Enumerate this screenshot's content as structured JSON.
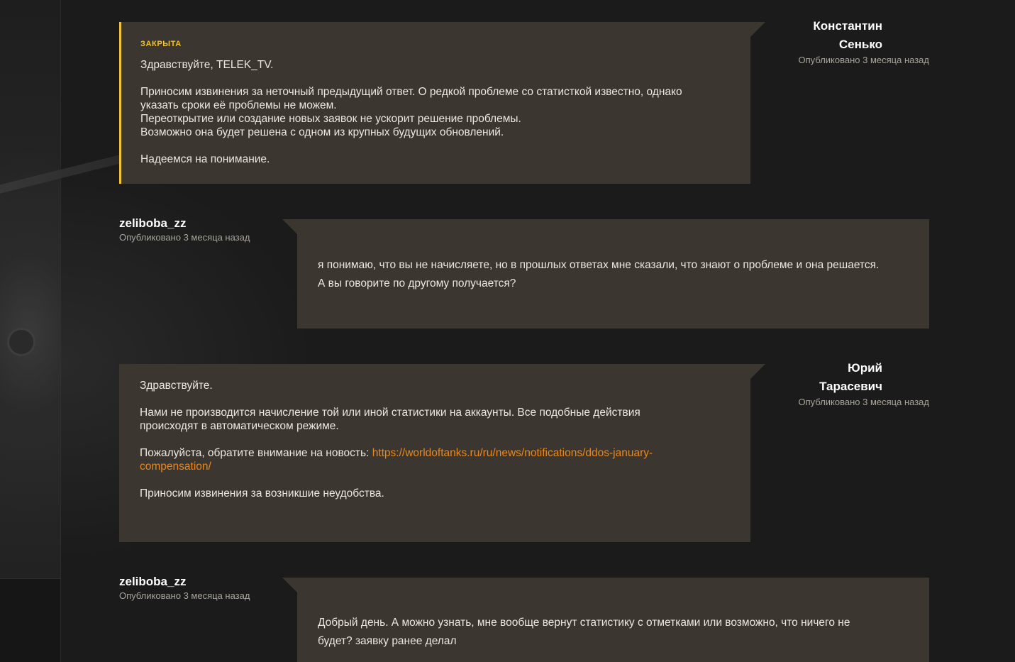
{
  "posts": [
    {
      "author_first": "Константин",
      "author_last": "Сенько",
      "meta": "Опубликовано 3 месяца назад",
      "status": "ЗАКРЫТА",
      "lines": {
        "greeting": "Здравствуйте, TELEK_TV.",
        "p1": "Приносим извинения за неточный предыдущий ответ. О редкой проблеме со статисткой известно, однако",
        "p2": "указать сроки её проблемы не можем.",
        "p3": "Переоткрытие или создание новых заявок не ускорит решение проблемы.",
        "p4": "Возможно она будет решена с одном из крупных будущих обновлений.",
        "closing": "Надеемся на понимание."
      }
    },
    {
      "author": "zeliboba_zz",
      "meta": "Опубликовано 3 месяца назад",
      "lines": {
        "l1": "я понимаю, что вы не начисляете, но в прошлых ответах мне сказали, что знают о проблеме и она решается.",
        "l2": "А вы говорите по другому получается?"
      }
    },
    {
      "author_first": "Юрий",
      "author_last": "Тарасевич",
      "meta": "Опубликовано 3 месяца назад",
      "lines": {
        "greeting": "Здравствуйте.",
        "p1": "Нами не производится начисление той или иной статистики на аккаунты. Все подобные действия",
        "p2": "происходят в автоматическом режиме.",
        "news_prefix": "Пожалуйста, обратите внимание на новость: ",
        "link_part1": "https://worldoftanks.ru/ru/news/notifications/ddos-january-",
        "link_part2": "compensation/",
        "closing": "Приносим извинения за возникшие неудобства."
      }
    },
    {
      "author": "zeliboba_zz",
      "meta": "Опубликовано 3 месяца назад",
      "lines": {
        "l1": "Добрый день. А можно узнать, мне вообще вернут статистику с отметками или возможно, что ничего не",
        "l2": "будет? заявку ранее делал"
      }
    }
  ],
  "colors": {
    "bubble": "#3b3730",
    "status_accent": "#f1c232",
    "link": "#e9871f",
    "background": "#1b1b1b"
  }
}
